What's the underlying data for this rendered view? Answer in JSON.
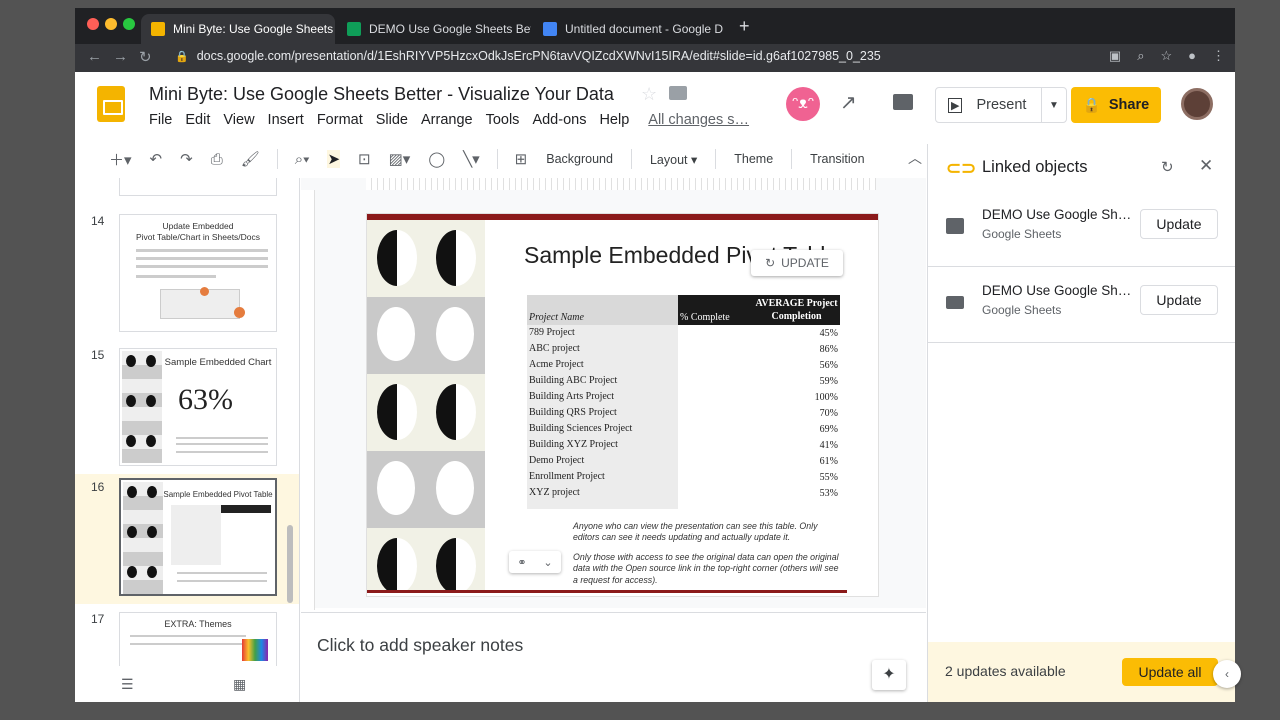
{
  "browser": {
    "tabs": [
      {
        "title": "Mini Byte: Use Google Sheets",
        "favicon_color": "#f4b400",
        "active": true
      },
      {
        "title": "DEMO Use Google Sheets Bett",
        "favicon_color": "#0f9d58",
        "active": false
      },
      {
        "title": "Untitled document - Google D",
        "favicon_color": "#4285f4",
        "active": false
      }
    ],
    "url": "docs.google.com/presentation/d/1EshRIYVP5HzcxOdkJsErcPN6tavVQIZcdXWNvI15IRA/edit#slide=id.g6af1027985_0_235"
  },
  "doc": {
    "title": "Mini Byte: Use Google Sheets Better - Visualize Your Data",
    "menus": [
      "File",
      "Edit",
      "View",
      "Insert",
      "Format",
      "Slide",
      "Arrange",
      "Tools",
      "Add-ons",
      "Help"
    ],
    "saved_status": "All changes s…"
  },
  "header": {
    "present_label": "Present",
    "share_label": "Share"
  },
  "toolbar": {
    "background": "Background",
    "layout": "Layout",
    "theme": "Theme",
    "transition": "Transition"
  },
  "filmstrip": {
    "slides": [
      {
        "num": "14",
        "title": "Update Embedded\nPivot Table/Chart in Sheets/Docs"
      },
      {
        "num": "15",
        "title": "Sample Embedded Chart",
        "big": "63%"
      },
      {
        "num": "16",
        "title": "Sample Embedded Pivot Table"
      },
      {
        "num": "17",
        "title": "EXTRA: Themes"
      }
    ]
  },
  "slide": {
    "title": "Sample Embedded Pivot Table",
    "update_chip": "UPDATE",
    "pivot": {
      "headers": [
        "Project Name",
        "% Complete",
        "AVERAGE Project Completion"
      ],
      "rows": [
        [
          "789 Project",
          "45%"
        ],
        [
          "ABC project",
          "86%"
        ],
        [
          "Acme Project",
          "56%"
        ],
        [
          "Building ABC Project",
          "59%"
        ],
        [
          "Building Arts Project",
          "100%"
        ],
        [
          "Building QRS Project",
          "70%"
        ],
        [
          "Building Sciences Project",
          "69%"
        ],
        [
          "Building XYZ Project",
          "41%"
        ],
        [
          "Demo Project",
          "61%"
        ],
        [
          "Enrollment Project",
          "55%"
        ],
        [
          "XYZ project",
          "53%"
        ]
      ]
    },
    "note1": "Anyone who can view the presentation can see this table. Only editors can see it needs updating and actually update it.",
    "note2": "Only those with access to see the original data can open the original data with the Open source link in the top-right corner (others will see a request for access)."
  },
  "speaker_notes": {
    "placeholder": "Click to add speaker notes"
  },
  "panel": {
    "title": "Linked objects",
    "items": [
      {
        "name": "DEMO Use Google Sh…",
        "source": "Google Sheets",
        "button": "Update"
      },
      {
        "name": "DEMO Use Google Sh…",
        "source": "Google Sheets",
        "button": "Update"
      }
    ],
    "updates_count": "2 updates available",
    "update_all": "Update all"
  }
}
